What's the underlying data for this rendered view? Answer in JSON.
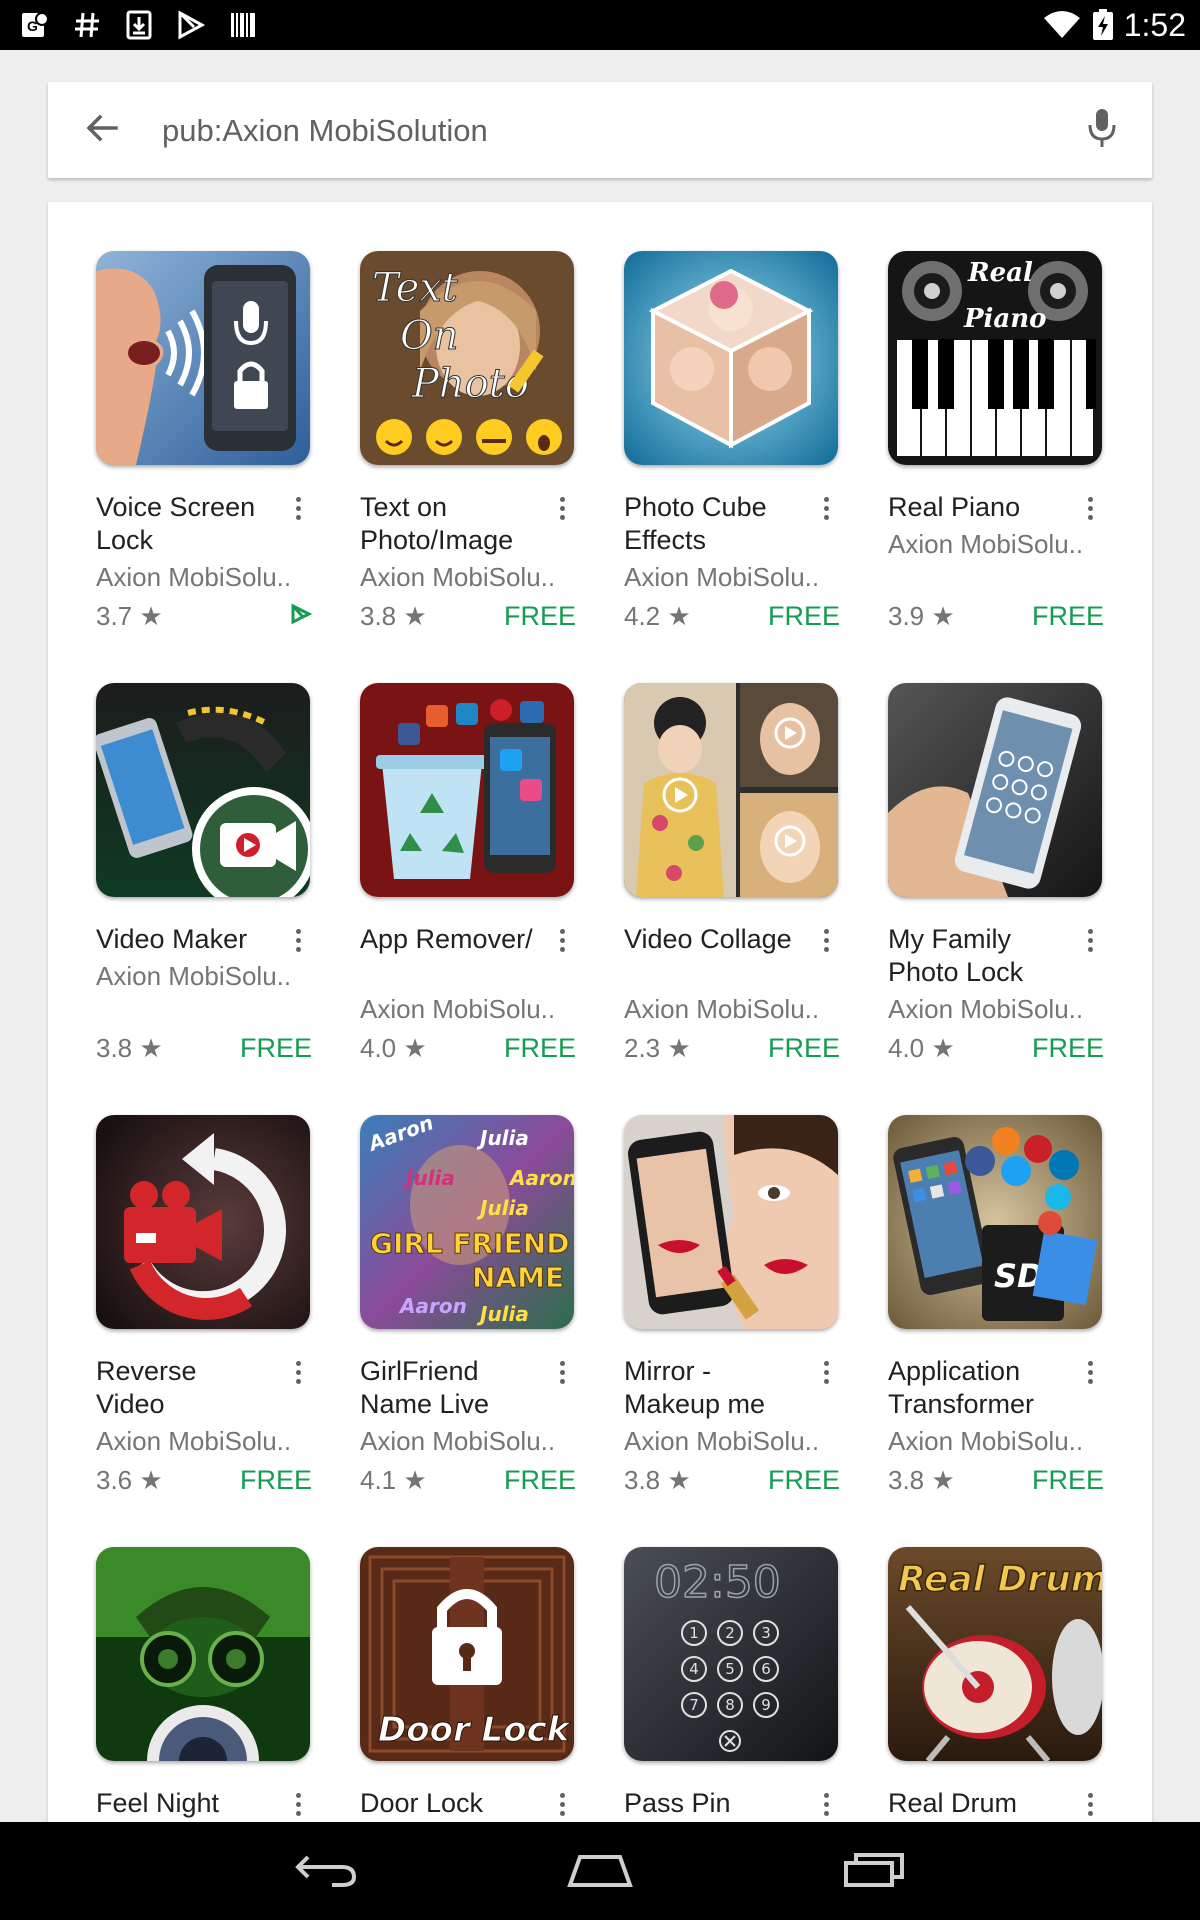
{
  "status_bar": {
    "time": "1:52",
    "icons": [
      "location-g-icon",
      "hash-icon",
      "download-icon",
      "play-store-icon",
      "barcode-icon",
      "wifi-icon",
      "battery-charging-icon"
    ]
  },
  "search": {
    "value": "pub:Axion MobiSolution",
    "back_icon": "arrow-back-icon",
    "mic_icon": "microphone-icon"
  },
  "apps": [
    {
      "title": "Voice Screen Lock",
      "developer": "Axion MobiSolu..",
      "rating": "3.7",
      "price": "",
      "installed_badge": "play-badge-icon"
    },
    {
      "title": "Text on Photo/Image",
      "developer": "Axion MobiSolu..",
      "rating": "3.8",
      "price": "FREE"
    },
    {
      "title": "Photo Cube Effects",
      "developer": "Axion MobiSolu..",
      "rating": "4.2",
      "price": "FREE"
    },
    {
      "title": "Real Piano",
      "developer": "Axion MobiSolu..",
      "rating": "3.9",
      "price": "FREE"
    },
    {
      "title": "Video Maker",
      "developer": "Axion MobiSolu..",
      "rating": "3.8",
      "price": "FREE"
    },
    {
      "title": "App Remover/",
      "developer": "Axion MobiSolu..",
      "rating": "4.0",
      "price": "FREE"
    },
    {
      "title": "Video Collage",
      "developer": "Axion MobiSolu..",
      "rating": "2.3",
      "price": "FREE"
    },
    {
      "title": "My Family Photo Lock",
      "developer": "Axion MobiSolu..",
      "rating": "4.0",
      "price": "FREE"
    },
    {
      "title": "Reverse Video",
      "developer": "Axion MobiSolu..",
      "rating": "3.6",
      "price": "FREE"
    },
    {
      "title": "GirlFriend Name Live",
      "developer": "Axion MobiSolu..",
      "rating": "4.1",
      "price": "FREE"
    },
    {
      "title": "Mirror - Makeup me",
      "developer": "Axion MobiSolu..",
      "rating": "3.8",
      "price": "FREE"
    },
    {
      "title": "Application Transformer",
      "developer": "Axion MobiSolu..",
      "rating": "3.8",
      "price": "FREE"
    },
    {
      "title": "Feel Night",
      "developer": "",
      "rating": "",
      "price": ""
    },
    {
      "title": "Door Lock",
      "developer": "",
      "rating": "",
      "price": ""
    },
    {
      "title": "Pass Pin",
      "developer": "",
      "rating": "",
      "price": ""
    },
    {
      "title": "Real Drum",
      "developer": "",
      "rating": "",
      "price": ""
    }
  ],
  "icon_text": {
    "text_on_photo": [
      "Text",
      "On",
      "Photo"
    ],
    "real_piano": [
      "Real",
      "Piano"
    ],
    "girlfriend": [
      "GIRL FRIEND",
      "NAME",
      "Aaron",
      "Julia"
    ],
    "door_lock": "Door Lock",
    "pass_pin_clock": "02:50",
    "pass_pin_keys": [
      "1",
      "2",
      "3",
      "4",
      "5",
      "6",
      "7",
      "8",
      "9"
    ],
    "real_drum": "Real Drum"
  },
  "nav": {
    "icons": [
      "back-nav-icon",
      "home-nav-icon",
      "recents-nav-icon"
    ]
  },
  "colors": {
    "price_green": "#159b52",
    "status_bar": "#000000",
    "background": "#eeeeee"
  }
}
